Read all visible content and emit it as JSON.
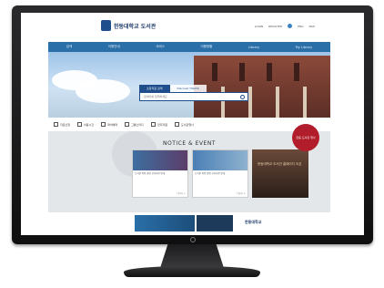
{
  "site": {
    "logo_text": "한동대학교 도서관",
    "util_links": [
      "LOGIN",
      "REGISTER",
      "ENG",
      "MAP"
    ],
    "nav": [
      "검색",
      "이용안내",
      "서비스",
      "이용현황",
      "Library",
      "My Library"
    ]
  },
  "search": {
    "tabs": [
      "소장자료 검색",
      "Discover HGUlib"
    ],
    "placeholder": "검색어를 입력하세요"
  },
  "quick_links": [
    "자료신청",
    "이용시간",
    "좌석예약",
    "그룹스터디",
    "전자자원",
    "도서관행사"
  ],
  "notice": {
    "title": "NOTICE & EVENT",
    "card1": {
      "text": "도서관 이용 관련 공지사항 안내",
      "more": "더보기 +"
    },
    "card2": {
      "text": "도서관 이용 관련 공지사항 안내",
      "more": "더보기 +"
    },
    "photo_text": "한동대학교 도서관 홈페이지 오픈"
  },
  "badge_text": "한동 도서관 행사",
  "footer": {
    "name": "한동대학교"
  },
  "colors": {
    "primary": "#1f4e8c",
    "nav": "#2a6fa8",
    "accent": "#b11d2a"
  }
}
